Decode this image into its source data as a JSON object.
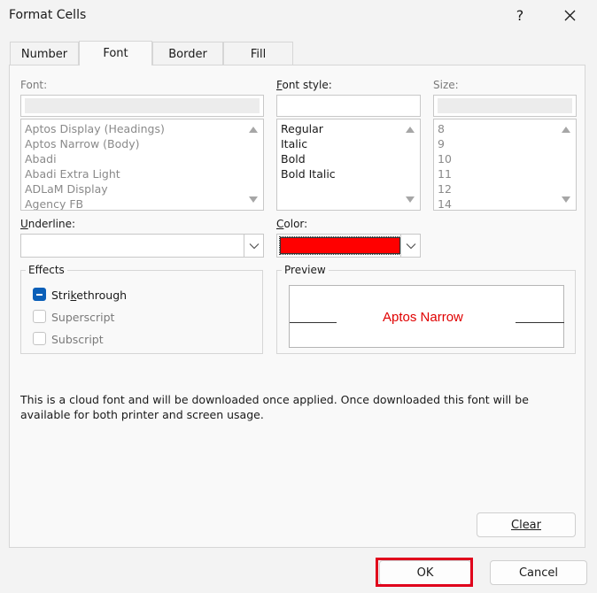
{
  "window": {
    "title": "Format Cells",
    "help": "?"
  },
  "tabs": [
    {
      "label": "Number"
    },
    {
      "label": "Font"
    },
    {
      "label": "Border"
    },
    {
      "label": "Fill"
    }
  ],
  "font": {
    "label": "Font:",
    "value": "",
    "items": [
      "Aptos Display (Headings)",
      "Aptos Narrow (Body)",
      "Abadi",
      "Abadi Extra Light",
      "ADLaM Display",
      "Agency FB"
    ]
  },
  "font_style": {
    "label_pre": "",
    "label_u": "F",
    "label_post": "ont style:",
    "value": "",
    "items": [
      "Regular",
      "Italic",
      "Bold",
      "Bold Italic"
    ]
  },
  "size": {
    "label": "Size:",
    "value": "",
    "items": [
      "8",
      "9",
      "10",
      "11",
      "12",
      "14"
    ]
  },
  "underline": {
    "label_u": "U",
    "label_post": "nderline:",
    "value": ""
  },
  "color": {
    "label_u": "C",
    "label_post": "olor:",
    "value_color": "#ff0000"
  },
  "effects": {
    "title": "Effects",
    "strikethrough": {
      "pre": "Stri",
      "u": "k",
      "post": "ethrough",
      "checked": true
    },
    "superscript": {
      "label": "Superscript",
      "checked": false
    },
    "subscript": {
      "label": "Subscript",
      "checked": false
    }
  },
  "preview": {
    "title": "Preview",
    "sample": "Aptos Narrow",
    "sample_color": "#e00000"
  },
  "info_text": "This is a cloud font and will be downloaded once applied. Once downloaded this font will be available for both printer and screen usage.",
  "buttons": {
    "clear": "Clear",
    "ok": "OK",
    "cancel": "Cancel"
  },
  "colors": {
    "accent": "#0a5fb8",
    "highlight": "#e0001b"
  }
}
